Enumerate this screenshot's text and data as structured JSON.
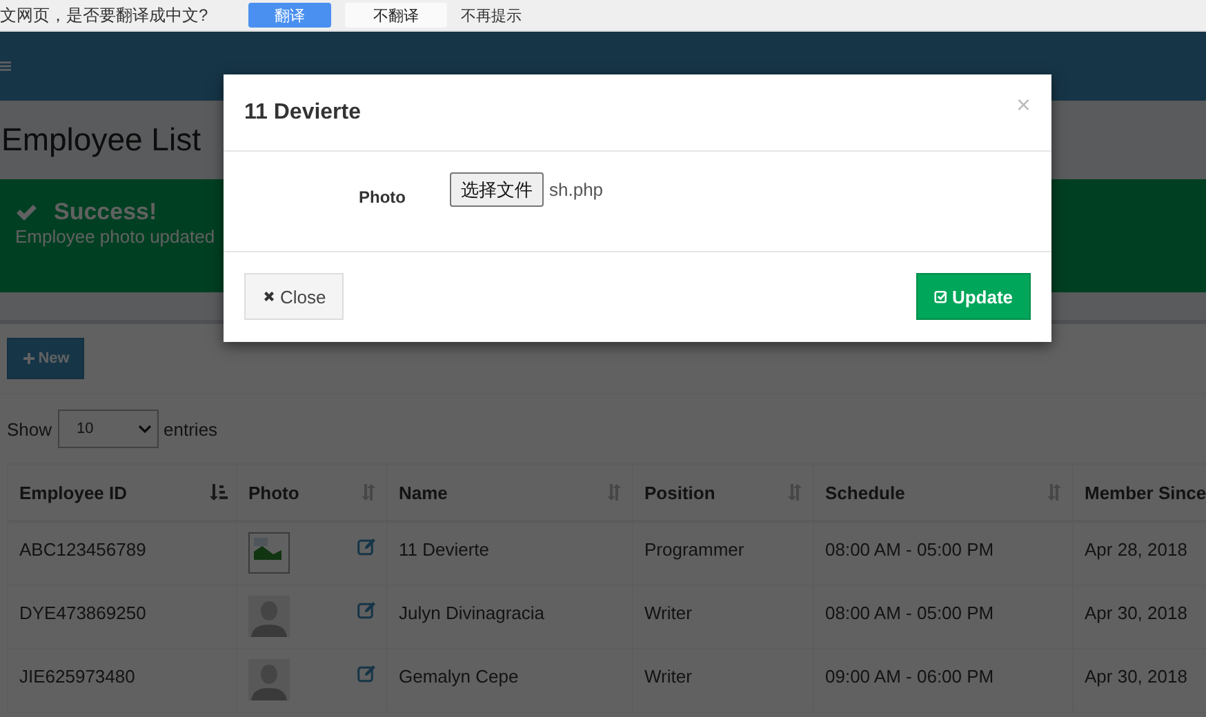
{
  "translate_bar": {
    "message": "文网页，是否要翻译成中文?",
    "buttons": [
      {
        "label": "翻译",
        "kind": "primary"
      },
      {
        "label": "不翻译",
        "kind": "plain"
      },
      {
        "label": "不再提示",
        "kind": "link"
      }
    ]
  },
  "page_title": "Employee List",
  "alert": {
    "title": "Success!",
    "message": "Employee photo updated"
  },
  "new_button": "New",
  "show_entries": {
    "before": "Show",
    "value": "10",
    "after": "entries"
  },
  "table": {
    "columns": [
      {
        "label": "Employee ID",
        "kind": "sorted"
      },
      {
        "label": "Photo",
        "kind": "sortable"
      },
      {
        "label": "Name",
        "kind": "sortable"
      },
      {
        "label": "Position",
        "kind": "sortable"
      },
      {
        "label": "Schedule",
        "kind": "sortable"
      },
      {
        "label": "Member Since",
        "kind": "plain"
      }
    ],
    "rows": [
      {
        "id": "ABC123456789",
        "photo": {
          "kind": "broken"
        },
        "name": "11 Devierte",
        "position": "Programmer",
        "schedule": "08:00 AM - 05:00 PM",
        "member_since": "Apr 28, 2018"
      },
      {
        "id": "DYE473869250",
        "photo": {
          "kind": "avatar"
        },
        "name": "Julyn Divinagracia",
        "position": "Writer",
        "schedule": "08:00 AM - 05:00 PM",
        "member_since": "Apr 30, 2018"
      },
      {
        "id": "JIE625973480",
        "photo": {
          "kind": "avatar"
        },
        "name": "Gemalyn Cepe",
        "position": "Writer",
        "schedule": "09:00 AM - 06:00 PM",
        "member_since": "Apr 30, 2018"
      }
    ]
  },
  "modal": {
    "title": "11 Devierte",
    "close_mark": "×",
    "field": {
      "label": "Photo",
      "button": "选择文件",
      "file_name": "sh.php"
    },
    "close_button": "Close",
    "update_button": "Update"
  }
}
